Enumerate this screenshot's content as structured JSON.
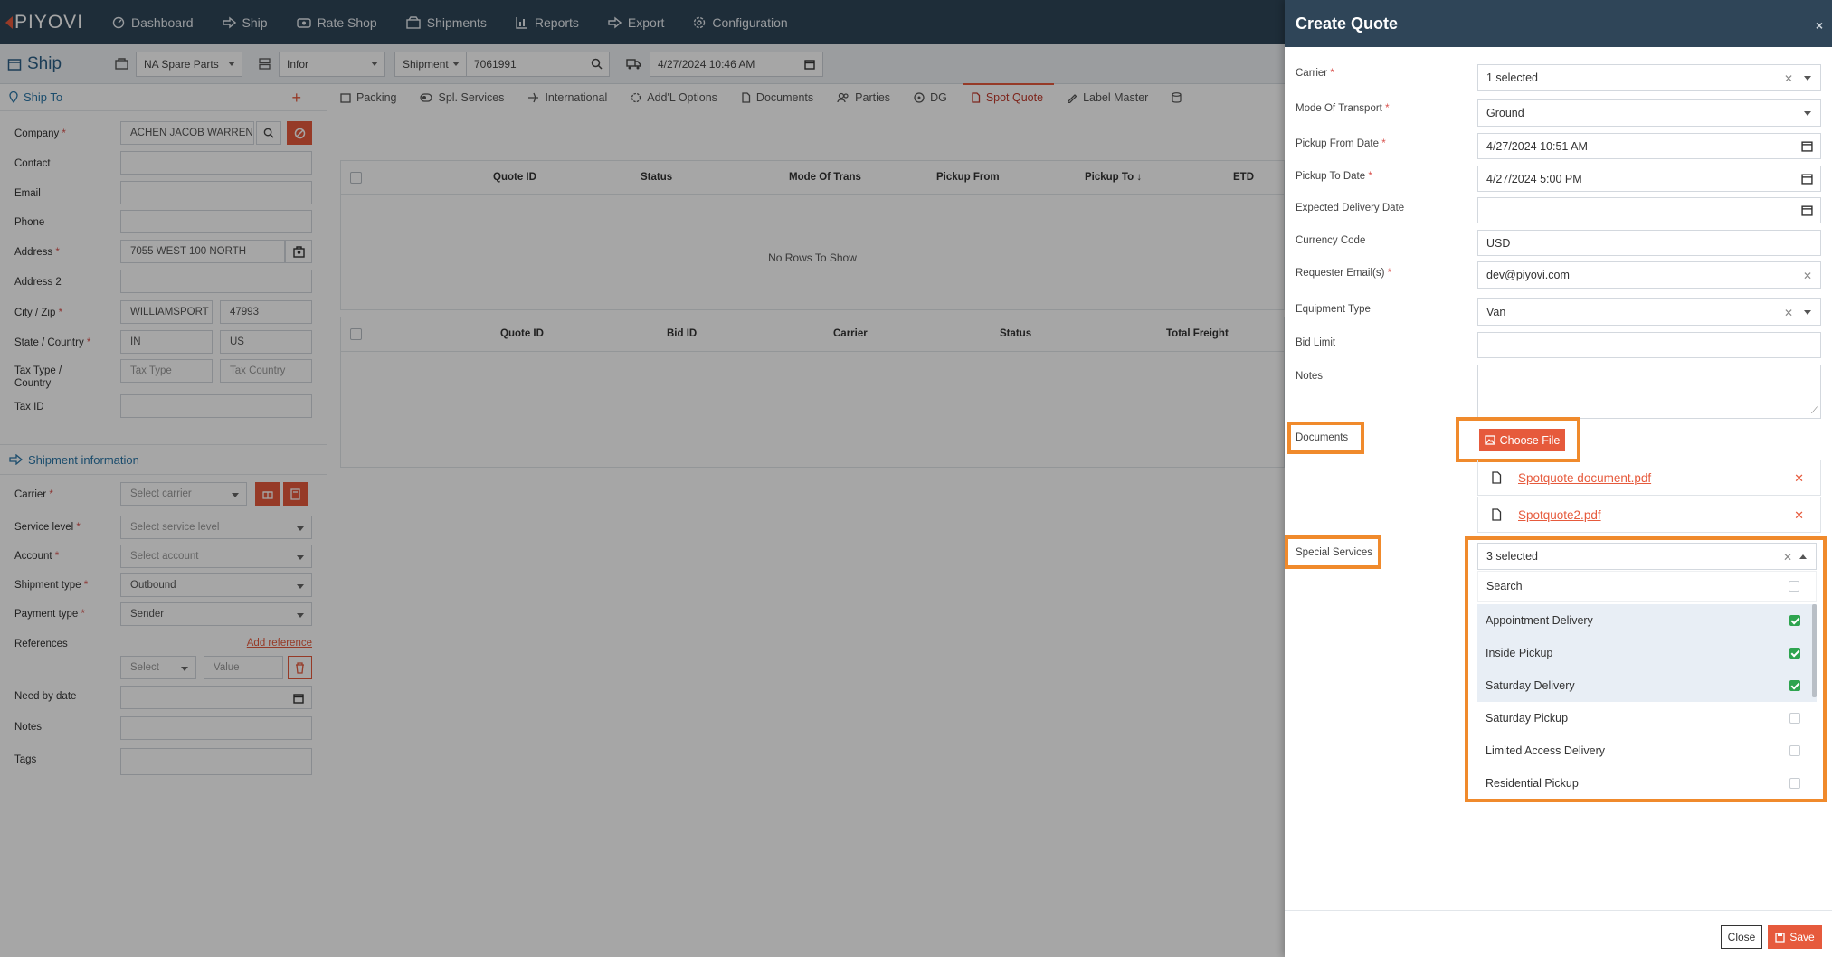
{
  "app": {
    "logo": "PIYOVI"
  },
  "nav": {
    "items": [
      "Dashboard",
      "Ship",
      "Rate Shop",
      "Shipments",
      "Reports",
      "Export",
      "Configuration"
    ]
  },
  "shipbar": {
    "title": "Ship",
    "location": "NA Spare Parts",
    "erp": "Infor",
    "ref_type": "Shipment",
    "ref_value": "7061991",
    "datetime": "4/27/2024 10:46 AM"
  },
  "ship_to": {
    "heading": "Ship To",
    "company_label": "Company",
    "company_value": "ACHEN JACOB WARREN I",
    "contact_label": "Contact",
    "email_label": "Email",
    "phone_label": "Phone",
    "address_label": "Address",
    "address_value": "7055 WEST 100 NORTH",
    "address2_label": "Address 2",
    "cityzip_label": "City / Zip",
    "city_value": "WILLIAMSPORT",
    "zip_value": "47993",
    "statecountry_label": "State / Country",
    "state_value": "IN",
    "country_value": "US",
    "taxtype_label": "Tax Type / Country",
    "taxtype_ph": "Tax Type",
    "taxcountry_ph": "Tax Country",
    "taxid_label": "Tax ID"
  },
  "shipment_info": {
    "heading": "Shipment information",
    "carrier_label": "Carrier",
    "carrier_ph": "Select carrier",
    "service_label": "Service level",
    "service_ph": "Select service level",
    "account_label": "Account",
    "account_ph": "Select account",
    "shiptype_label": "Shipment type",
    "shiptype_value": "Outbound",
    "paytype_label": "Payment type",
    "paytype_value": "Sender",
    "refs_label": "References",
    "add_ref": "Add reference",
    "ref_select": "Select",
    "ref_value_ph": "Value",
    "needby_label": "Need by date",
    "notes_label": "Notes",
    "tags_label": "Tags"
  },
  "tabs": [
    "Packing",
    "Spl. Services",
    "International",
    "Add'L Options",
    "Documents",
    "Parties",
    "DG",
    "Spot Quote",
    "Label Master"
  ],
  "grid1": {
    "columns": [
      "Quote ID",
      "Status",
      "Mode Of Trans",
      "Pickup From",
      "Pickup To",
      "ETD"
    ],
    "empty": "No Rows To Show"
  },
  "grid2": {
    "columns": [
      "Quote ID",
      "Bid ID",
      "Carrier",
      "Status",
      "Total Freight"
    ]
  },
  "modal": {
    "title": "Create Quote",
    "close_x": "×",
    "carrier_label": "Carrier",
    "carrier_value": "1 selected",
    "mode_label": "Mode Of Transport",
    "mode_value": "Ground",
    "pickup_from_label": "Pickup From Date",
    "pickup_from_value": "4/27/2024 10:51 AM",
    "pickup_to_label": "Pickup To Date",
    "pickup_to_value": "4/27/2024 5:00 PM",
    "expected_label": "Expected Delivery Date",
    "currency_label": "Currency Code",
    "currency_value": "USD",
    "requester_label": "Requester Email(s)",
    "requester_value": "dev@piyovi.com",
    "equipment_label": "Equipment Type",
    "equipment_value": "Van",
    "bid_label": "Bid Limit",
    "notes_label": "Notes",
    "documents_label": "Documents",
    "choose_file": "Choose File",
    "docs": [
      "Spotquote document.pdf",
      "Spotquote2.pdf"
    ],
    "special_label": "Special Services",
    "special_value": "3 selected",
    "search_ph": "Search",
    "options": [
      {
        "label": "Appointment Delivery",
        "checked": true
      },
      {
        "label": "Inside Pickup",
        "checked": true
      },
      {
        "label": "Saturday Delivery",
        "checked": true
      },
      {
        "label": "Saturday Pickup",
        "checked": false
      },
      {
        "label": "Limited Access Delivery",
        "checked": false
      },
      {
        "label": "Residential Pickup",
        "checked": false
      }
    ],
    "close_btn": "Close",
    "save_btn": "Save",
    "highlight_color": "#f08a2c"
  }
}
